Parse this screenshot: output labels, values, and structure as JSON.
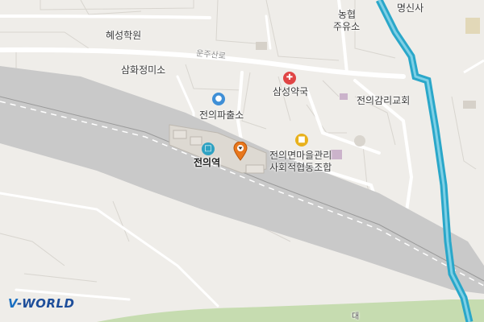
{
  "map": {
    "road_label": "운주산로",
    "logo": {
      "prefix": "V",
      "suffix": "-WORLD"
    },
    "places": {
      "hyeseong": "혜성학원",
      "samhwa": "삼화정미소",
      "police": "전의파출소",
      "station": "전의역",
      "samsung": "삼성약국",
      "church": "전의감리교회",
      "nonghyup_1": "농협",
      "nonghyup_2": "주유소",
      "myeongsin": "명신사",
      "coop_1": "전의면마을관리",
      "coop_2": "사회적협동조합",
      "bottom_cut": "대"
    },
    "icons": {
      "police": "police-icon",
      "station": "train-station-icon",
      "pharmacy": "pharmacy-icon",
      "coop": "building-icon",
      "pin": "location-pin-icon"
    },
    "colors": {
      "background": "#efede9",
      "river": "#2aa7c9",
      "rail_yard": "#c9c9c9",
      "green_belt": "#c6dcb0",
      "pin": "#e8771c"
    }
  }
}
